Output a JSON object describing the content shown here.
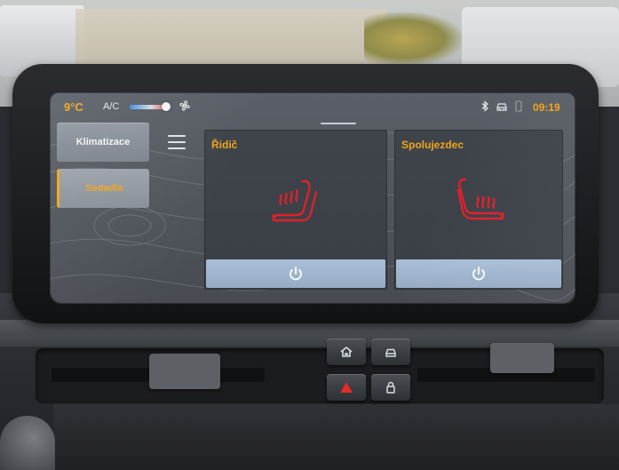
{
  "status_bar": {
    "temperature": "9°C",
    "ac_label": "A/C",
    "fan_icon": "fan-icon",
    "bluetooth_icon": "bluetooth-icon",
    "car_icon": "car-icon",
    "phone_icon": "phone-icon",
    "clock": "09:19"
  },
  "sidebar": {
    "items": [
      {
        "label": "Klimatizace",
        "icon": ""
      },
      {
        "label": "Sedadla",
        "icon": ""
      }
    ],
    "menu_icon": "hamburger-menu-icon"
  },
  "seats": {
    "driver": {
      "title": "Řidič",
      "icon": "heated-seat-icon",
      "power_icon": "power-icon"
    },
    "passenger": {
      "title": "Spolujezdec",
      "icon": "heated-seat-icon",
      "power_icon": "power-icon"
    }
  },
  "hardware_buttons": {
    "home_icon": "home-icon",
    "car_icon": "car-icon",
    "hazard_icon": "hazard-warning-icon",
    "lock_icon": "lock-icon"
  },
  "colors": {
    "accent_orange": "#f0a51a",
    "heat_red": "#e0202a",
    "power_bar_blue": "#a9bfd8",
    "panel_gray": "#3f444b"
  }
}
